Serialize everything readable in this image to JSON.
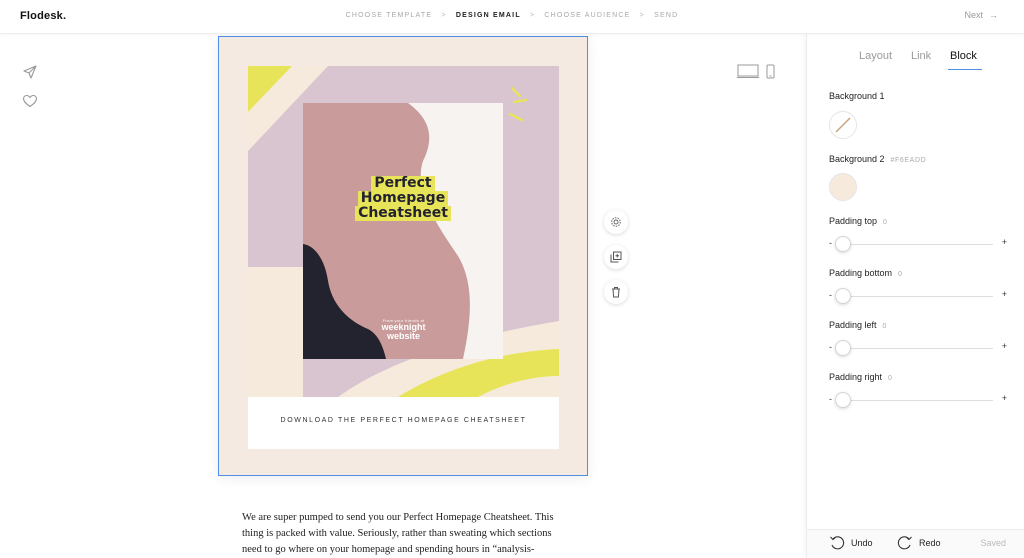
{
  "app": {
    "logo": "Flodesk."
  },
  "steps": [
    {
      "label": "CHOOSE TEMPLATE",
      "active": false
    },
    {
      "label": "DESIGN EMAIL",
      "active": true
    },
    {
      "label": "CHOOSE AUDIENCE",
      "active": false
    },
    {
      "label": "SEND",
      "active": false
    }
  ],
  "step_separator": ">",
  "header": {
    "next_label": "Next",
    "next_arrow": "→"
  },
  "email": {
    "hero_title_lines": [
      "Perfect",
      "Homepage",
      "Cheatsheet"
    ],
    "hero_small_text": "From your friends at",
    "hero_brand_lines": [
      "weeknight",
      "website"
    ],
    "caption": "DOWNLOAD THE PERFECT HOMEPAGE CHEATSHEET",
    "body_text": "We are super pumped to send you our Perfect Homepage Cheatsheet. This thing is packed with value. Seriously, rather than sweating which sections need to go where on your homepage and spending hours in “analysis-"
  },
  "panel": {
    "tabs": [
      "Layout",
      "Link",
      "Block"
    ],
    "active_tab": "Block",
    "background1_label": "Background 1",
    "background2_label": "Background 2",
    "background2_value": "#F6EADD",
    "padding": [
      {
        "label": "Padding top",
        "value": "0",
        "level": 0
      },
      {
        "label": "Padding bottom",
        "value": "0",
        "level": 0
      },
      {
        "label": "Padding left",
        "value": "0",
        "level": 0
      },
      {
        "label": "Padding right",
        "value": "0",
        "level": 0
      }
    ],
    "minus": "-",
    "plus": "+"
  },
  "footer": {
    "undo_label": "Undo",
    "redo_label": "Redo",
    "saved_label": "Saved"
  },
  "colors": {
    "accent": "#4F8FE6",
    "mauve": "#D8C5CF",
    "rose": "#C99C9B",
    "navy": "#23222F",
    "yellow": "#E8E45A",
    "cream": "#F6EADD",
    "offwhite": "#F6F3F0"
  },
  "icons": {
    "send": "send-icon",
    "heart": "heart-icon",
    "desktop": "desktop-icon",
    "mobile": "mobile-icon",
    "settings": "gear-icon",
    "duplicate": "duplicate-icon",
    "delete": "trash-icon",
    "undo": "undo-icon",
    "redo": "redo-icon"
  }
}
